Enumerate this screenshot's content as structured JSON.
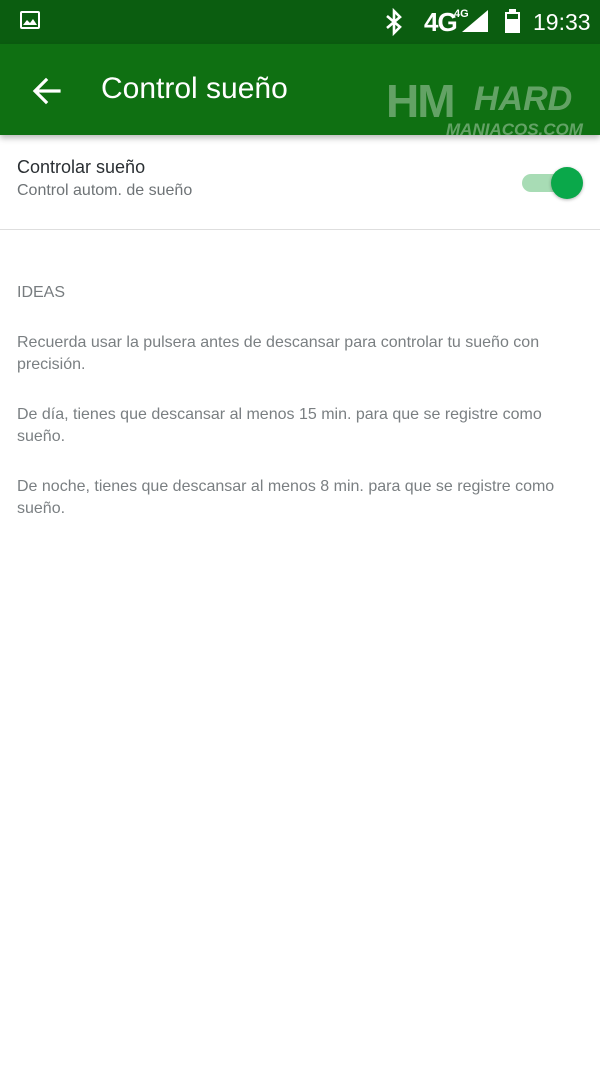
{
  "status_bar": {
    "network_type": "4G",
    "network_sup": "4G",
    "time": "19:33",
    "icons": [
      "image-notification-icon",
      "bluetooth-icon",
      "signal-icon",
      "battery-icon"
    ]
  },
  "toolbar": {
    "title": "Control sueño",
    "back_icon": "arrow-back-icon",
    "color": "#0f7012"
  },
  "watermark": {
    "hm": "HM",
    "hard": "HARD",
    "sub": "MANIACOS.COM"
  },
  "setting": {
    "title": "Controlar sueño",
    "subtitle": "Control autom. de sueño",
    "toggle_on": true,
    "accent": "#0aa84a"
  },
  "ideas": {
    "header": "IDEAS",
    "tips": [
      "Recuerda usar la pulsera antes de descansar para controlar tu sueño con precisión.",
      "De día, tienes que descansar al menos 15 min. para que se registre como sueño.",
      "De noche, tienes que descansar al menos 8 min. para que se registre como sueño."
    ]
  }
}
